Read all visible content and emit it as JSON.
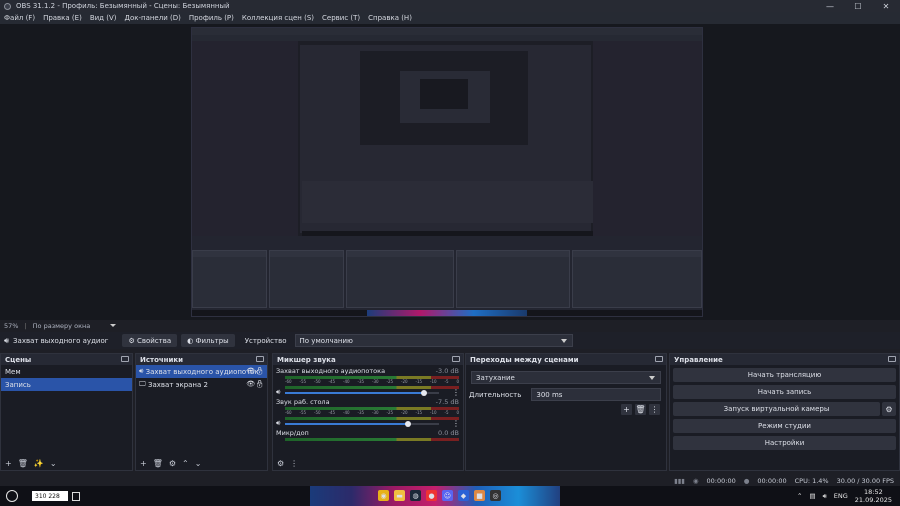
{
  "window": {
    "title": "OBS 31.1.2 - Профиль: Безымянный - Сцены: Безымянный",
    "minimize": "—",
    "maximize": "☐",
    "close": "✕"
  },
  "menu": [
    "Файл (F)",
    "Правка (E)",
    "Вид (V)",
    "Док-панели (D)",
    "Профиль (P)",
    "Коллекция сцен (S)",
    "Сервис (T)",
    "Справка (H)"
  ],
  "zoom": {
    "value": "57%",
    "mode": "По размеру окна"
  },
  "source_bar": {
    "source_name": "Захват выходного аудиог",
    "properties": "Свойства",
    "filters": "Фильтры",
    "device_label": "Устройство",
    "device_value": "По умолчанию"
  },
  "scenes": {
    "title": "Сцены",
    "items": [
      "Мем",
      "Запись"
    ],
    "selected": 1
  },
  "sources": {
    "title": "Источники",
    "items": [
      "Захват выходного аудиопоток",
      "Захват экрана 2"
    ]
  },
  "mixer": {
    "title": "Микшер звука",
    "channels": [
      {
        "name": "Захват выходного аудиопотока",
        "db": "-3.0 dB",
        "level": 0.9
      },
      {
        "name": "Звук раб. стола",
        "db": "-7.5 dB",
        "level": 0.8
      },
      {
        "name": "Микр/доп",
        "db": "0.0 dB",
        "level": 1.0
      }
    ],
    "ticks": [
      "-60",
      "-55",
      "-50",
      "-45",
      "-40",
      "-35",
      "-30",
      "-25",
      "-20",
      "-15",
      "-10",
      "-5",
      "0"
    ]
  },
  "transitions": {
    "title": "Переходы между сценами",
    "type": "Затухание",
    "duration_label": "Длительность",
    "duration": "300 ms"
  },
  "controls": {
    "title": "Управление",
    "start_stream": "Начать трансляцию",
    "start_record": "Начать запись",
    "virtual_cam": "Запуск виртуальной камеры",
    "studio": "Режим студии",
    "settings": "Настройки"
  },
  "status": {
    "stream_time": "00:00:00",
    "rec_time": "00:00:00",
    "cpu": "CPU: 1.4%",
    "fps": "30.00 / 30.00 FPS"
  },
  "taskbar": {
    "search_text": "310 228",
    "lang": "ENG",
    "time": "18:52",
    "date": "21.09.2025"
  }
}
